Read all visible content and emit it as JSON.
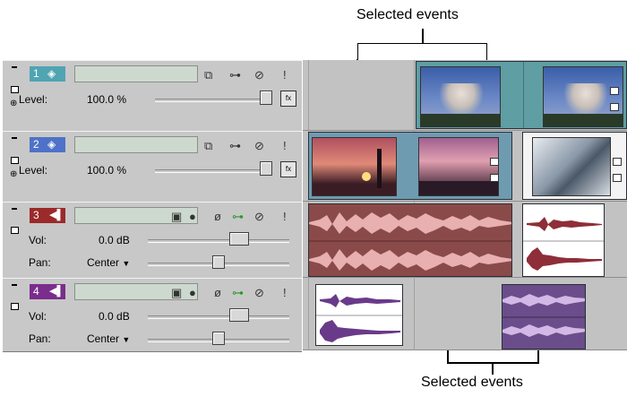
{
  "callouts": {
    "top": "Selected events",
    "bottom": "Selected events"
  },
  "tracks": [
    {
      "number": "1",
      "type": "video",
      "color": "#4fa5b2",
      "param_label": "Level:",
      "param_value": "100.0 %",
      "level": 1.0
    },
    {
      "number": "2",
      "type": "video",
      "color": "#4f72c8",
      "param_label": "Level:",
      "param_value": "100.0 %",
      "level": 1.0
    },
    {
      "number": "3",
      "type": "audio",
      "color": "#9b2a2a",
      "vol_label": "Vol:",
      "vol_value": "0.0 dB",
      "pan_label": "Pan:",
      "pan_value": "Center",
      "volume": 0.65,
      "pan": 0.5
    },
    {
      "number": "4",
      "type": "audio",
      "color": "#7a2d8c",
      "vol_label": "Vol:",
      "vol_value": "0.0 dB",
      "pan_label": "Pan:",
      "pan_value": "Center",
      "volume": 0.65,
      "pan": 0.5
    }
  ],
  "icons": {
    "minimize": "minimize-icon",
    "video_track": "video-track-icon",
    "audio_track": "speaker-icon",
    "compositing": "compositing-mode-icon",
    "motion": "track-motion-icon",
    "fx": "track-fx-icon",
    "mute": "mute-icon",
    "solo": "solo-icon",
    "invert": "invert-phase-icon",
    "arm": "arm-record-icon",
    "pan_crop": "event-pan-crop-icon",
    "event_fx": "event-fx-icon"
  },
  "colors": {
    "video_event": "#5f9ea3",
    "video_event_alt": "#6f9bb1",
    "audio_event_selected": "#8b4a4a",
    "audio_event_purple": "#6a4d8a",
    "waveform_red": "#e8b0b0",
    "waveform_purple": "#d2b8e6"
  }
}
